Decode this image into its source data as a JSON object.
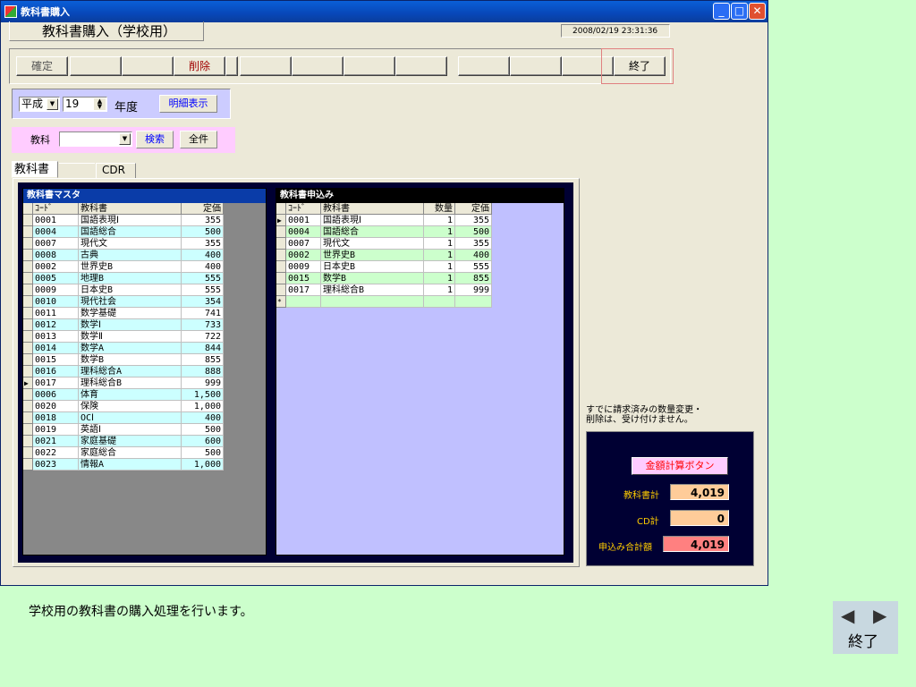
{
  "window": {
    "title": "教科書購入",
    "form_title": "教科書購入（学校用）",
    "datetime": "2008/02/19 23:31:36",
    "controls": {
      "minimize": "_",
      "maximize": "□",
      "close": "✕"
    }
  },
  "toolbar": {
    "buttons": [
      "確定",
      "",
      "",
      "削除",
      "",
      "",
      "",
      "",
      "",
      "",
      "",
      "終了"
    ]
  },
  "era": {
    "era_value": "平成",
    "year_value": "19",
    "year_suffix": "年度",
    "detail_label": "明細表示"
  },
  "subject": {
    "label": "教科",
    "value": "",
    "search_label": "検索",
    "all_label": "全件"
  },
  "tabs": [
    "教科書",
    "CDR"
  ],
  "master": {
    "caption": "教科書マスタ",
    "headers": [
      "ｺｰﾄﾞ",
      "教科書",
      "定価"
    ],
    "current_row": 15,
    "rows": [
      [
        "0001",
        "国語表現Ⅰ",
        "355"
      ],
      [
        "0004",
        "国語総合",
        "500"
      ],
      [
        "0007",
        "現代文",
        "355"
      ],
      [
        "0008",
        "古典",
        "400"
      ],
      [
        "0002",
        "世界史B",
        "400"
      ],
      [
        "0005",
        "地理B",
        "555"
      ],
      [
        "0009",
        "日本史B",
        "555"
      ],
      [
        "0010",
        "現代社会",
        "354"
      ],
      [
        "0011",
        "数学基礎",
        "741"
      ],
      [
        "0012",
        "数学Ⅰ",
        "733"
      ],
      [
        "0013",
        "数学Ⅱ",
        "722"
      ],
      [
        "0014",
        "数学A",
        "844"
      ],
      [
        "0015",
        "数学B",
        "855"
      ],
      [
        "0016",
        "理科総合A",
        "888"
      ],
      [
        "0017",
        "理科総合B",
        "999"
      ],
      [
        "0006",
        "体育",
        "1,500"
      ],
      [
        "0020",
        "保険",
        "1,000"
      ],
      [
        "0018",
        "OCⅠ",
        "400"
      ],
      [
        "0019",
        "英語Ⅰ",
        "500"
      ],
      [
        "0021",
        "家庭基礎",
        "600"
      ],
      [
        "0022",
        "家庭総合",
        "500"
      ],
      [
        "0023",
        "情報A",
        "1,000"
      ]
    ]
  },
  "order": {
    "caption": "教科書申込み",
    "headers": [
      "ｺｰﾄﾞ",
      "教科書",
      "数量",
      "定価"
    ],
    "current_row": 0,
    "rows": [
      [
        "0001",
        "国語表現Ⅰ",
        "1",
        "355"
      ],
      [
        "0004",
        "国語総合",
        "1",
        "500"
      ],
      [
        "0007",
        "現代文",
        "1",
        "355"
      ],
      [
        "0002",
        "世界史B",
        "1",
        "400"
      ],
      [
        "0009",
        "日本史B",
        "1",
        "555"
      ],
      [
        "0015",
        "数学B",
        "1",
        "855"
      ],
      [
        "0017",
        "理科総合B",
        "1",
        "999"
      ]
    ],
    "new_row_marker": "*"
  },
  "notice": [
    "すでに請求済みの数量変更・",
    "削除は、受け付けません。"
  ],
  "totals": {
    "calc_button": "金額計算ボタン",
    "textbook_label": "教科書計",
    "textbook_value": "4,019",
    "cd_label": "CD計",
    "cd_value": "0",
    "grand_label": "申込み合計額",
    "grand_value": "4,019"
  },
  "footer": {
    "description": "学校用の教科書の購入処理を行います。",
    "prev": "◀",
    "next": "▶",
    "exit": "終了"
  },
  "colors": {
    "page_bg": "#ccffcc",
    "master_row_alt": "#ccffff",
    "order_row_alt": "#ccffcc",
    "textbook_total_bg": "#ffcc99",
    "grand_total_bg": "#ff8080"
  }
}
